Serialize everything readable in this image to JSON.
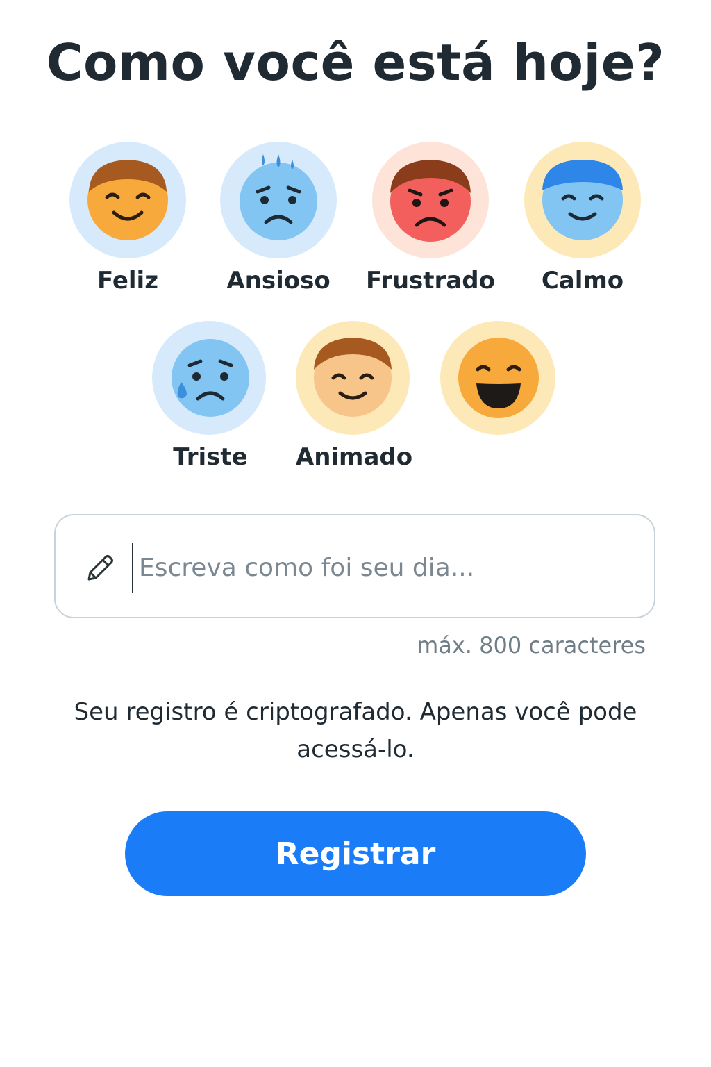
{
  "header": {
    "title": "Como você está hoje?"
  },
  "moods": [
    {
      "label": "Feliz",
      "icon": "happy-face-icon",
      "halo_color": "#d6eafc",
      "face_color": "#f7a93b"
    },
    {
      "label": "Ansioso",
      "icon": "anxious-face-icon",
      "halo_color": "#d6eafc",
      "face_color": "#82c4f2"
    },
    {
      "label": "Frustrado",
      "icon": "frustrated-face-icon",
      "halo_color": "#fde3d8",
      "face_color": "#f25f5c"
    },
    {
      "label": "Calmo",
      "icon": "calm-face-icon",
      "halo_color": "#fde9b8",
      "face_color": "#82c4f2"
    },
    {
      "label": "Triste",
      "icon": "sad-face-icon",
      "halo_color": "#d6eafc",
      "face_color": "#82c4f2"
    },
    {
      "label": "Animado",
      "icon": "excited-face-icon",
      "halo_color": "#fde9b8",
      "face_color": "#f7c48a"
    },
    {
      "label": "",
      "icon": "grinning-face-icon",
      "halo_color": "#fde9b8",
      "face_color": "#f7a93b"
    }
  ],
  "journal": {
    "placeholder": "Escreva como foi seu dia...",
    "value": "",
    "icon": "pencil-icon",
    "limit_text": "máx. 800 caracteres"
  },
  "privacy_notice": "Seu registro é criptografado. Apenas você pode acessá-lo.",
  "submit": {
    "label": "Registrar",
    "color": "#1a7cf7"
  }
}
